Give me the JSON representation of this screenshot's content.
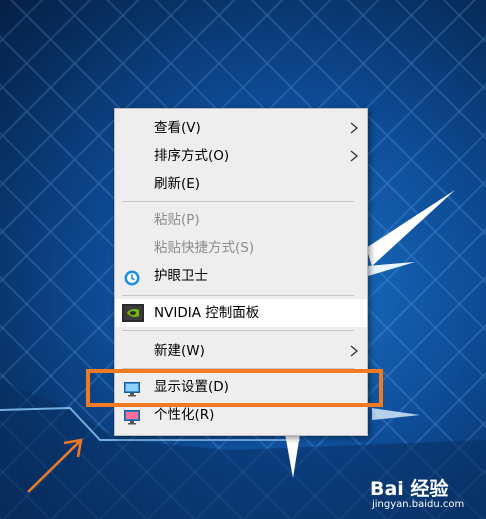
{
  "context_menu": {
    "items": [
      {
        "label": "查看(V)",
        "has_submenu": true,
        "enabled": true
      },
      {
        "label": "排序方式(O)",
        "has_submenu": true,
        "enabled": true
      },
      {
        "label": "刷新(E)",
        "has_submenu": false,
        "enabled": true
      },
      {
        "label": "粘贴(P)",
        "has_submenu": false,
        "enabled": false
      },
      {
        "label": "粘贴快捷方式(S)",
        "has_submenu": false,
        "enabled": false
      },
      {
        "label": "护眼卫士",
        "has_submenu": false,
        "enabled": true,
        "icon": "eye-guard-icon"
      },
      {
        "label": "NVIDIA 控制面板",
        "has_submenu": false,
        "enabled": true,
        "icon": "nvidia-icon"
      },
      {
        "label": "新建(W)",
        "has_submenu": true,
        "enabled": true
      },
      {
        "label": "显示设置(D)",
        "has_submenu": false,
        "enabled": true,
        "icon": "display-settings-icon"
      },
      {
        "label": "个性化(R)",
        "has_submenu": false,
        "enabled": true,
        "icon": "personalize-icon"
      }
    ]
  },
  "annotation": {
    "highlight_color": "#f07a22",
    "highlighted_item": "显示设置(D)"
  },
  "watermark": {
    "title": "Bai 经验",
    "url": "jingyan.baidu.com"
  }
}
